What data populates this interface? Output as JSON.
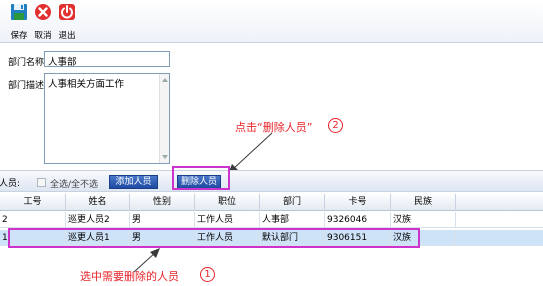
{
  "toolbar": {
    "save_label": "保存",
    "cancel_label": "取消",
    "exit_label": "退出"
  },
  "form": {
    "name_label": "部门名称",
    "name_value": "人事部",
    "desc_label": "部门描述",
    "desc_value": "人事相关方面工作"
  },
  "annotations": {
    "delete_hint": "点击“删除人员”",
    "delete_num": "2",
    "select_hint": "选中需要删除的人员",
    "select_num": "1"
  },
  "members": {
    "label": "人员:",
    "select_all_label": "全选/全不选",
    "add_button": "添加人员",
    "delete_button": "删除人员"
  },
  "table": {
    "columns": [
      "工号",
      "姓名",
      "性别",
      "职位",
      "部门",
      "卡号",
      "民族"
    ],
    "rows": [
      {
        "marker": "2",
        "id": "",
        "name": "巡更人员2",
        "gender": "男",
        "position": "工作人员",
        "dept": "人事部",
        "card": "9326046",
        "ethnicity": "汉族"
      },
      {
        "marker": "1",
        "id": "",
        "name": "巡更人员1",
        "gender": "男",
        "position": "工作人员",
        "dept": "默认部门",
        "card": "9306151",
        "ethnicity": "汉族"
      }
    ]
  },
  "colors": {
    "annotation": "#e8242a",
    "highlight": "#cc33cc",
    "button": "#1e4aa2",
    "selected_row": "#cfe3f8"
  }
}
